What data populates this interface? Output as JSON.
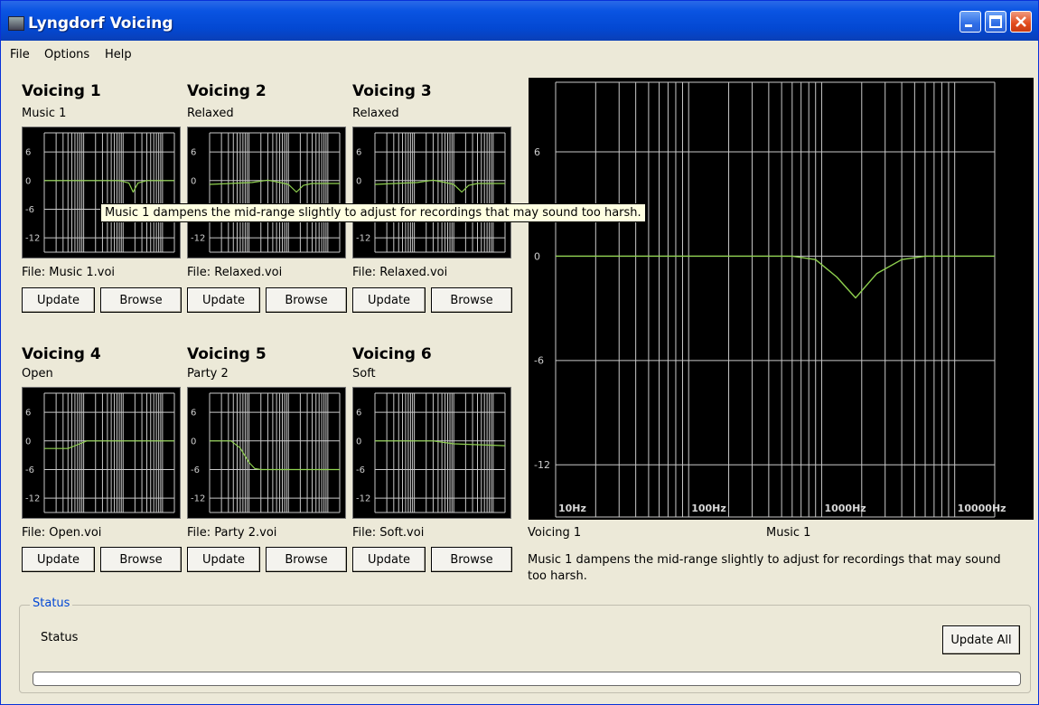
{
  "window": {
    "title": "Lyngdorf Voicing"
  },
  "menu": [
    "File",
    "Options",
    "Help"
  ],
  "voicings": [
    {
      "title": "Voicing 1",
      "name": "Music 1",
      "file": "File: Music 1.voi",
      "curve": [
        [
          10,
          0
        ],
        [
          800,
          0
        ],
        [
          1400,
          -0.5
        ],
        [
          1800,
          -2.4
        ],
        [
          2400,
          -0.5
        ],
        [
          4000,
          0
        ],
        [
          20000,
          0
        ]
      ]
    },
    {
      "title": "Voicing 2",
      "name": "Relaxed",
      "file": "File: Relaxed.voi",
      "curve": [
        [
          10,
          -0.8
        ],
        [
          120,
          -0.4
        ],
        [
          300,
          0.1
        ],
        [
          600,
          -0.4
        ],
        [
          1000,
          -0.8
        ],
        [
          1600,
          -2.4
        ],
        [
          2400,
          -1.0
        ],
        [
          4000,
          -0.6
        ],
        [
          20000,
          -0.6
        ]
      ]
    },
    {
      "title": "Voicing 3",
      "name": "Relaxed",
      "file": "File: Relaxed.voi",
      "curve": [
        [
          10,
          -0.8
        ],
        [
          120,
          -0.4
        ],
        [
          300,
          0.1
        ],
        [
          600,
          -0.4
        ],
        [
          1000,
          -0.8
        ],
        [
          1600,
          -2.4
        ],
        [
          2400,
          -1.0
        ],
        [
          4000,
          -0.6
        ],
        [
          20000,
          -0.6
        ]
      ]
    },
    {
      "title": "Voicing 4",
      "name": "Open",
      "file": "File: Open.voi",
      "curve": [
        [
          10,
          -1.6
        ],
        [
          40,
          -1.6
        ],
        [
          70,
          -0.8
        ],
        [
          120,
          0
        ],
        [
          20000,
          0
        ]
      ]
    },
    {
      "title": "Voicing 5",
      "name": "Party 2",
      "file": "File: Party 2.voi",
      "curve": [
        [
          10,
          0
        ],
        [
          35,
          0
        ],
        [
          60,
          -1.5
        ],
        [
          100,
          -4.5
        ],
        [
          140,
          -5.8
        ],
        [
          200,
          -6
        ],
        [
          20000,
          -6
        ]
      ]
    },
    {
      "title": "Voicing 6",
      "name": "Soft",
      "file": "File: Soft.voi",
      "curve": [
        [
          10,
          0
        ],
        [
          300,
          0
        ],
        [
          1000,
          -0.6
        ],
        [
          20000,
          -1.0
        ]
      ]
    }
  ],
  "buttons": {
    "update": "Update",
    "browse": "Browse",
    "update_all": "Update All"
  },
  "thumb_ticks": [
    "6",
    "0",
    "-6",
    "-12"
  ],
  "big_graph": {
    "y_ticks": [
      "6",
      "0",
      "-6",
      "-12"
    ],
    "x_labels": [
      "10Hz",
      "100Hz",
      "1000Hz",
      "10000Hz"
    ],
    "ylim": [
      -15,
      10
    ],
    "xlim": [
      10,
      20000
    ],
    "curve": [
      [
        10,
        0
      ],
      [
        600,
        0
      ],
      [
        900,
        -0.2
      ],
      [
        1300,
        -1.2
      ],
      [
        1800,
        -2.4
      ],
      [
        2600,
        -1.0
      ],
      [
        4000,
        -0.2
      ],
      [
        6000,
        0
      ],
      [
        20000,
        0
      ]
    ]
  },
  "selected": {
    "voicing": "Voicing 1",
    "name": "Music 1",
    "description": "Music 1 dampens the mid-range slightly to adjust for recordings that may sound too harsh."
  },
  "tooltip": "Music 1 dampens the mid-range slightly to adjust for recordings that may sound too harsh.",
  "status": {
    "legend": "Status",
    "text": "Status",
    "progress": 0
  },
  "colors": {
    "curve": "#8fd14f",
    "grid": "#c8c8c8",
    "plot_bg": "#000000",
    "window_bg": "#ece9d8",
    "title_bar": "#0a54e2"
  }
}
